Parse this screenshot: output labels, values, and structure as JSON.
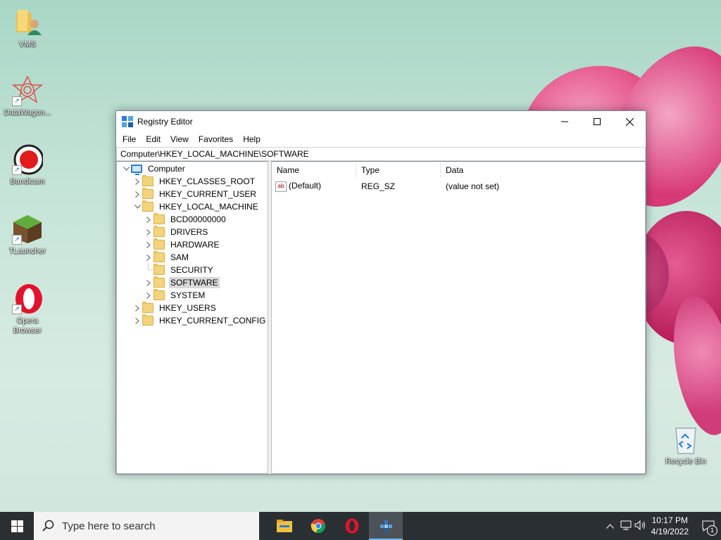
{
  "desktop": {
    "icons": [
      {
        "label": "VMS"
      },
      {
        "label": "DataWagon..."
      },
      {
        "label": "Bandicam"
      },
      {
        "label": "TLauncher"
      },
      {
        "label": "Opera Browser"
      },
      {
        "label": "Recycle Bin"
      }
    ]
  },
  "window": {
    "title": "Registry Editor",
    "menu": [
      "File",
      "Edit",
      "View",
      "Favorites",
      "Help"
    ],
    "address": "Computer\\HKEY_LOCAL_MACHINE\\SOFTWARE",
    "tree": [
      {
        "label": "Computer",
        "level": 0,
        "chevron": "expanded",
        "icon": "computer-icon"
      },
      {
        "label": "HKEY_CLASSES_ROOT",
        "level": 1,
        "chevron": "collapsed"
      },
      {
        "label": "HKEY_CURRENT_USER",
        "level": 1,
        "chevron": "collapsed"
      },
      {
        "label": "HKEY_LOCAL_MACHINE",
        "level": 1,
        "chevron": "expanded"
      },
      {
        "label": "BCD00000000",
        "level": 2,
        "chevron": "collapsed"
      },
      {
        "label": "DRIVERS",
        "level": 2,
        "chevron": "collapsed"
      },
      {
        "label": "HARDWARE",
        "level": 2,
        "chevron": "collapsed"
      },
      {
        "label": "SAM",
        "level": 2,
        "chevron": "collapsed"
      },
      {
        "label": "SECURITY",
        "level": 2,
        "chevron": "none"
      },
      {
        "label": "SOFTWARE",
        "level": 2,
        "chevron": "collapsed",
        "selected": true
      },
      {
        "label": "SYSTEM",
        "level": 2,
        "chevron": "collapsed"
      },
      {
        "label": "HKEY_USERS",
        "level": 1,
        "chevron": "collapsed"
      },
      {
        "label": "HKEY_CURRENT_CONFIG",
        "level": 1,
        "chevron": "collapsed"
      }
    ],
    "columns": [
      "Name",
      "Type",
      "Data"
    ],
    "values": [
      {
        "name": "(Default)",
        "type": "REG_SZ",
        "data": "(value not set)"
      }
    ]
  },
  "taskbar": {
    "search_placeholder": "Type here to search",
    "time": "10:17 PM",
    "date": "4/19/2022",
    "notification_count": "1"
  }
}
